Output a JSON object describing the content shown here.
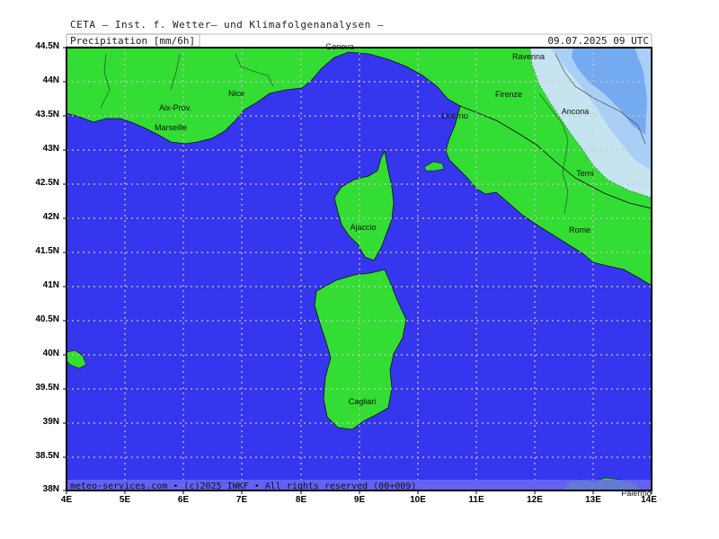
{
  "header": {
    "source": "CETA — Inst. f. Wetter— und Klimafolgenanalysen —",
    "field": "Precipitation [mm/6h]",
    "valid_time": "09.07.2025  09 UTC"
  },
  "footer": {
    "credit": "meteo-services.com • (c)2025 IWKF • All rights reserved (00+009)"
  },
  "axes": {
    "lat_labels": [
      "44.5N",
      "44N",
      "43.5N",
      "43N",
      "42.5N",
      "42N",
      "41.5N",
      "41N",
      "40.5N",
      "40N",
      "39.5N",
      "39N",
      "38.5N",
      "38N"
    ],
    "lon_labels": [
      "4E",
      "5E",
      "6E",
      "7E",
      "8E",
      "9E",
      "10E",
      "11E",
      "12E",
      "13E",
      "14E"
    ]
  },
  "places": [
    {
      "name": "Genova"
    },
    {
      "name": "Ravenna"
    },
    {
      "name": "Nice"
    },
    {
      "name": "Firenze"
    },
    {
      "name": "Aix-Prov."
    },
    {
      "name": "Livorno"
    },
    {
      "name": "Ancona"
    },
    {
      "name": "Marseille"
    },
    {
      "name": "Terni"
    },
    {
      "name": "Ajaccio"
    },
    {
      "name": "Rome"
    },
    {
      "name": "Cagliari"
    },
    {
      "name": "Palermo"
    }
  ],
  "colors": {
    "sea": "#3636ee",
    "land": "#33dd33",
    "precip_light": "#cfe4fb",
    "precip_mid": "#a9cff7",
    "precip_heavy": "#74aaf0",
    "grid": "#c8c8c8"
  }
}
